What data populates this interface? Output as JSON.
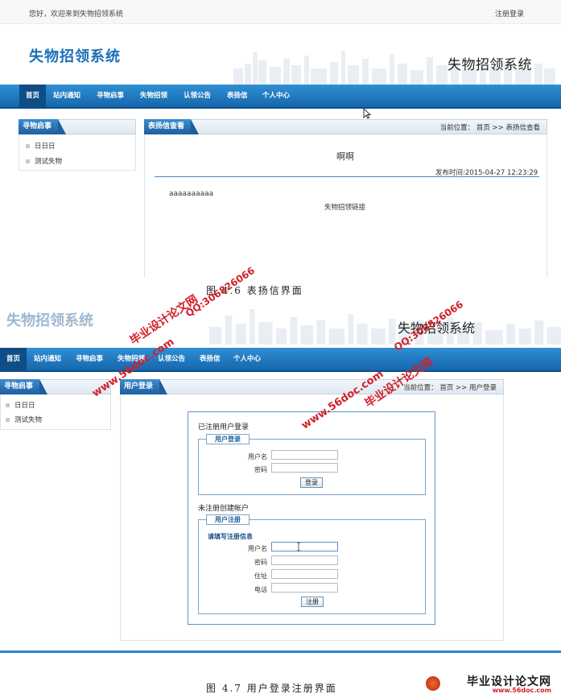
{
  "shot1": {
    "welcome": "您好，欢迎来到失物招领系统",
    "register_login": "注册登录",
    "logo_left": "失物招领系统",
    "logo_right": "失物招领系统",
    "nav": [
      "首页",
      "站内通知",
      "寻物启事",
      "失物招领",
      "认领公告",
      "表扬信",
      "个人中心"
    ],
    "active_nav": "首页",
    "sidebar": {
      "title": "寻物启事",
      "items": [
        "日日日",
        "测试失物"
      ]
    },
    "main": {
      "title": "表扬信查看",
      "breadcrumb": "当前位置： 首页 >>  表扬信查看",
      "article_title": "啊啊",
      "publish_time": "发布时间:2015-04-27 12:23:29",
      "content": "aaaaaaaaaa",
      "link": "失物招领链接"
    },
    "caption": "图 4.6 表扬信界面"
  },
  "shot2": {
    "logo_left": "失物招领系统",
    "logo_right": "失物招领系统",
    "nav": [
      "首页",
      "站内通知",
      "寻物启事",
      "失物招领",
      "认领公告",
      "表扬信",
      "个人中心"
    ],
    "sidebar": {
      "title": "寻物启事",
      "items": [
        "日日日",
        "测试失物"
      ]
    },
    "main": {
      "title": "用户登录",
      "breadcrumb": "当前位置： 首页 >>  用户登录"
    },
    "login": {
      "section_title": "已注册用户登录",
      "legend": "用户登录",
      "username_label": "用户名",
      "password_label": "密码",
      "submit": "登录"
    },
    "register": {
      "section_title": "未注册创建帐户",
      "legend": "用户注册",
      "hint": "请填写注册信息",
      "username_label": "用户名",
      "password_label": "密码",
      "address_label": "住址",
      "phone_label": "电话",
      "submit": "注册"
    },
    "caption": "图 4.7 用户登录注册界面"
  },
  "watermarks": {
    "site_cn": "毕业设计论文网",
    "url": "www.56doc.com",
    "qq": "QQ:306826066"
  },
  "footer_logo": {
    "brand": "毕业设计论文网",
    "url": "www.56doc.com"
  }
}
